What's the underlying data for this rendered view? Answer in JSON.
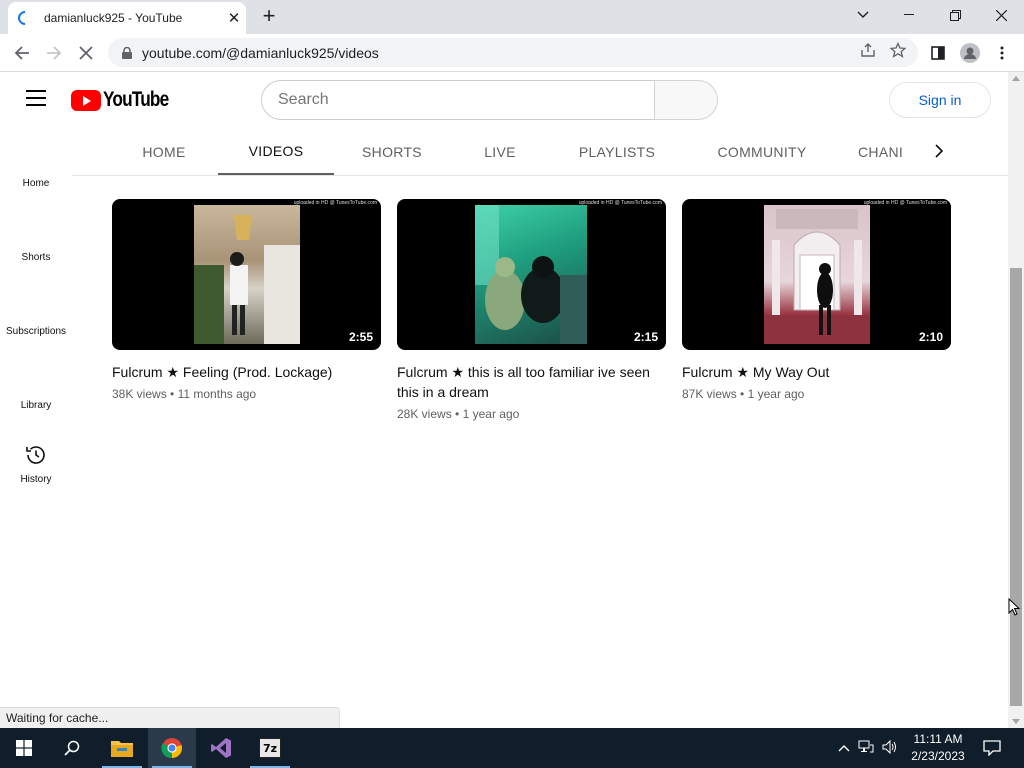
{
  "browser": {
    "tab_title": "damianluck925 - YouTube",
    "tab_close": "✕",
    "new_tab": "+",
    "url": "youtube.com/@damianluck925/videos"
  },
  "youtube": {
    "logo_text": "YouTube",
    "search_placeholder": "Search",
    "signin_label": "Sign in"
  },
  "guide": {
    "items": [
      {
        "label": "Home",
        "icon": "home-icon"
      },
      {
        "label": "Shorts",
        "icon": "shorts-icon"
      },
      {
        "label": "Subscriptions",
        "icon": "subscriptions-icon"
      },
      {
        "label": "Library",
        "icon": "library-icon"
      },
      {
        "label": "History",
        "icon": "history-icon"
      }
    ]
  },
  "channel_tabs": {
    "tabs": [
      {
        "label": "HOME"
      },
      {
        "label": "VIDEOS"
      },
      {
        "label": "SHORTS"
      },
      {
        "label": "LIVE"
      },
      {
        "label": "PLAYLISTS"
      },
      {
        "label": "COMMUNITY"
      },
      {
        "label": "CHANI"
      }
    ],
    "active": "VIDEOS"
  },
  "videos": [
    {
      "title": "Fulcrum ★ Feeling (Prod. Lockage)",
      "duration": "2:55",
      "views": "38K views",
      "age": "11 months ago",
      "watermark": "uploaded in HD @ TunesToTube.com"
    },
    {
      "title": "Fulcrum ★ this is all too familiar ive seen this in a dream",
      "duration": "2:15",
      "views": "28K views",
      "age": "1 year ago",
      "watermark": "uploaded in HD @ TunesToTube.com"
    },
    {
      "title": "Fulcrum ★ My Way Out",
      "duration": "2:10",
      "views": "87K views",
      "age": "1 year ago",
      "watermark": "uploaded in HD @ TunesToTube.com"
    }
  ],
  "meta_separator": "•",
  "status_text": "Waiting for cache...",
  "taskbar": {
    "time": "11:11 AM",
    "date": "2/23/2023",
    "apps": [
      "start-icon",
      "search-icon",
      "file-explorer-icon",
      "chrome-icon",
      "visual-studio-icon",
      "7zip-icon"
    ],
    "sevenzip_label": "7z"
  },
  "colors": {
    "youtube_red": "#ff0000",
    "link_blue": "#065fd4",
    "taskbar_bg": "#101d2a"
  }
}
